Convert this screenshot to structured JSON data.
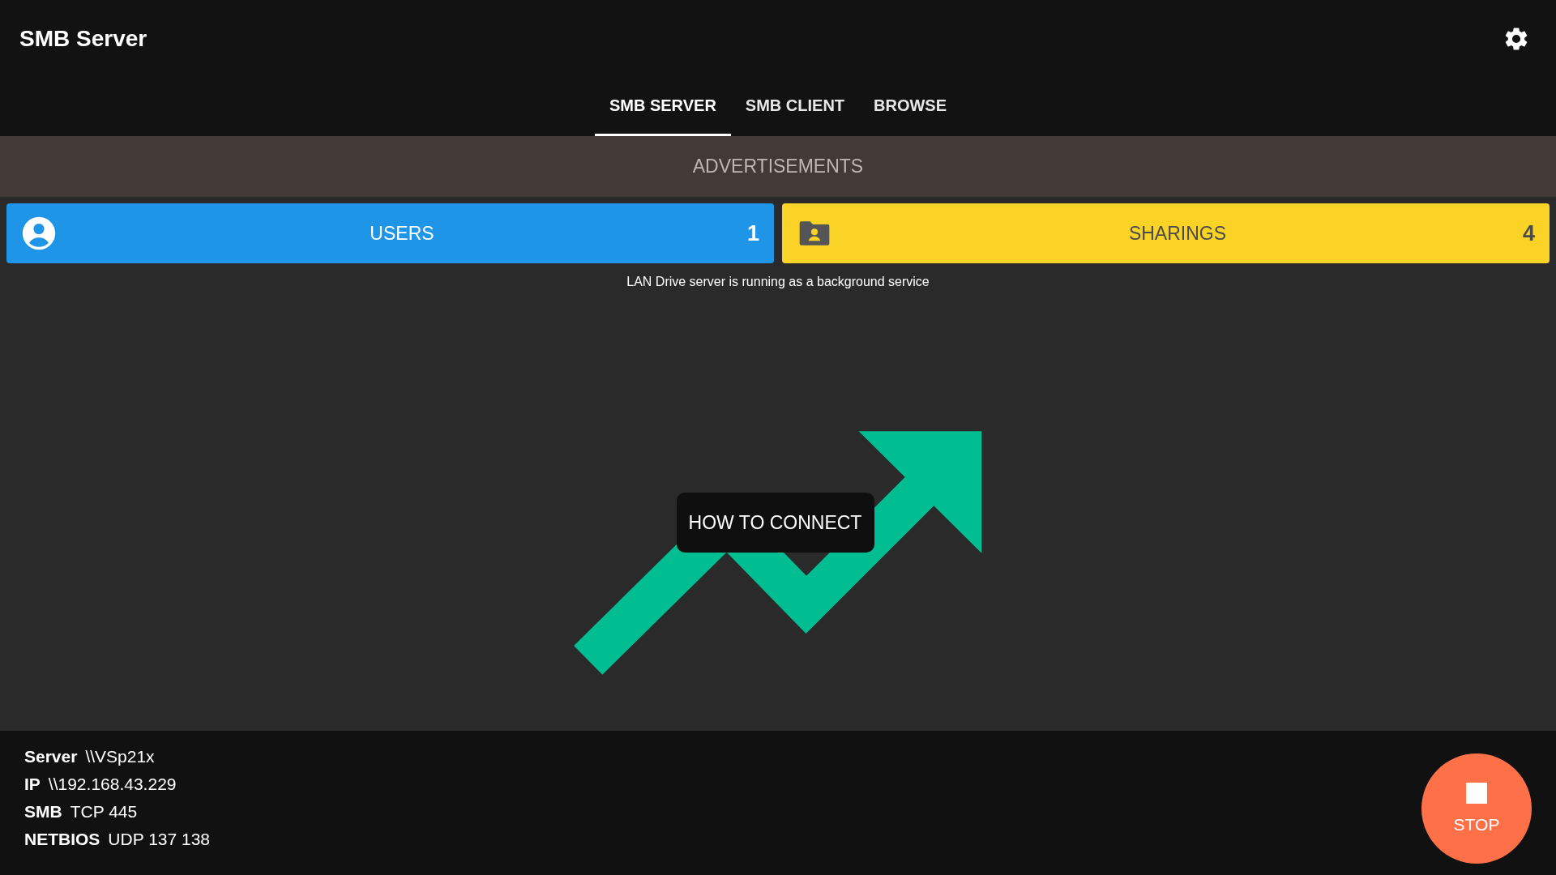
{
  "app_bar": {
    "title": "SMB Server"
  },
  "tabs": [
    {
      "label": "SMB SERVER",
      "selected": true
    },
    {
      "label": "SMB CLIENT",
      "selected": false
    },
    {
      "label": "BROWSE",
      "selected": false
    }
  ],
  "ad_banner": {
    "label": "ADVERTISEMENTS"
  },
  "cards": [
    {
      "kind": "users",
      "label": "USERS",
      "count": "1",
      "color": "#1e95e6"
    },
    {
      "kind": "sharings",
      "label": "SHARINGS",
      "count": "4",
      "color": "#fbd326"
    }
  ],
  "status_message": "LAN Drive server is running as a background service",
  "connect_button": {
    "label": "HOW TO CONNECT"
  },
  "info": [
    {
      "label": "Server",
      "value": "\\\\VSp21x"
    },
    {
      "label": "IP",
      "value": "\\\\192.168.43.229"
    },
    {
      "label": "SMB",
      "value": "TCP 445"
    },
    {
      "label": "NETBIOS",
      "value": "UDP 137 138"
    }
  ],
  "stop_button": {
    "label": "STOP"
  }
}
